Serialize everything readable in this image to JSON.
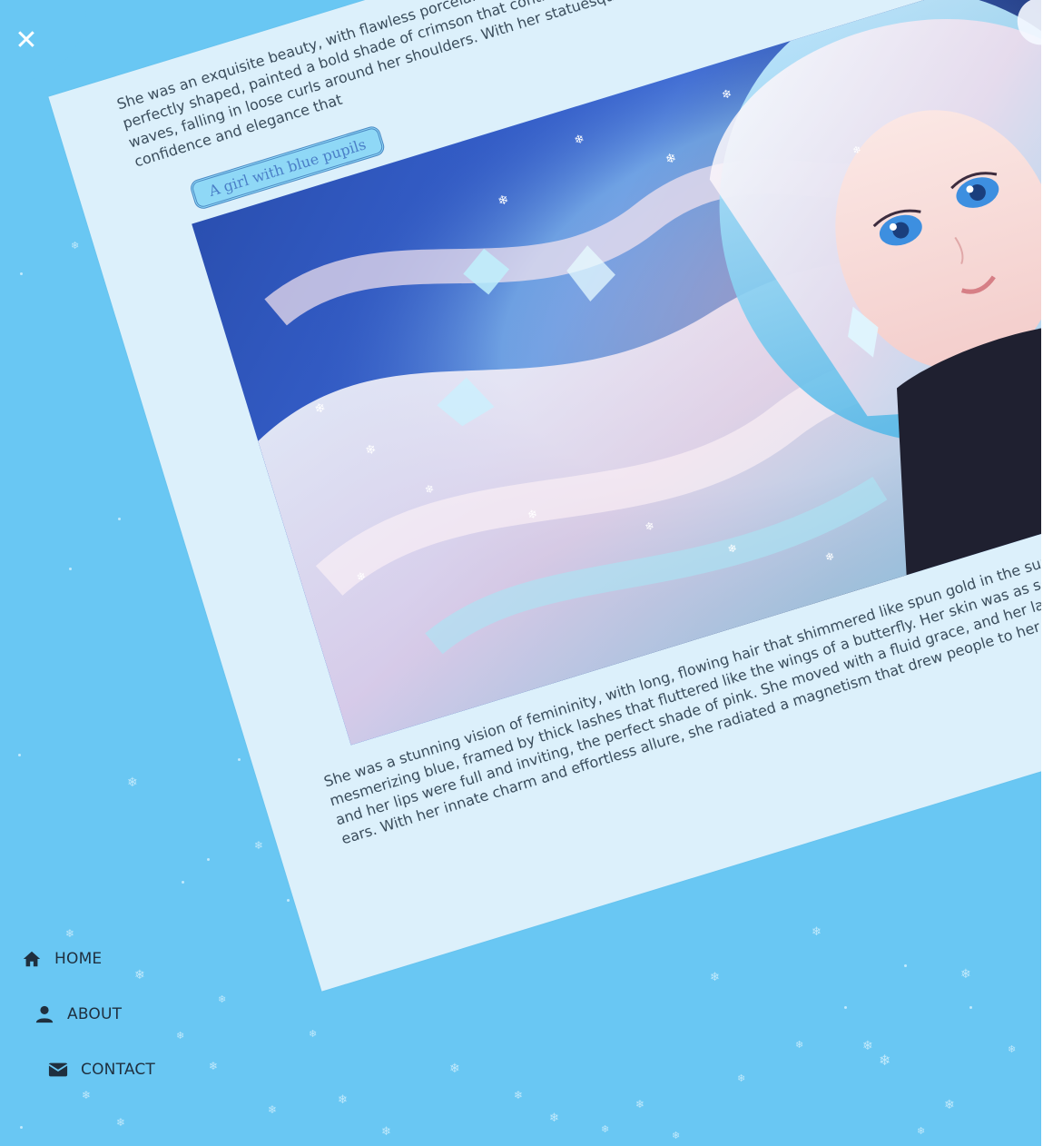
{
  "close": {
    "glyph": "✕"
  },
  "article": {
    "paragraph_top": "She was an exquisite beauty, with flawless porcelain skin and piercing eyes that sparkled like diamonds. Her lips were full and perfectly shaped, painted a bold shade of crimson that contrasted beautifully with her fair skin. Her hair was a cascade of chestnut waves, falling in loose curls around her shoulders. With her statuesque figure and graceful movements, she exuded an aura of confidence and elegance that",
    "caption": "A girl with blue pupils",
    "paragraph_bottom": "She was a stunning vision of femininity, with long, flowing hair that shimmered like spun gold in the sun. Her eyes were a deep, mesmerizing blue, framed by thick lashes that fluttered like the wings of a butterfly. Her skin was as soft as the petals of a rose, and her lips were full and inviting, the perfect shade of pink. She moved with a fluid grace, and her laughter was like music to the ears. With her innate charm and effortless allure, she radiated a magnetism that drew people to her like moths to a flame."
  },
  "nav": {
    "items": [
      {
        "label": "HOME",
        "icon": "home-icon"
      },
      {
        "label": "ABOUT",
        "icon": "user-icon"
      },
      {
        "label": "CONTACT",
        "icon": "envelope-icon"
      }
    ]
  },
  "colors": {
    "background": "#69c7f3",
    "card": "#dcf0fb",
    "caption_bg": "#8fd8f6",
    "caption_text": "#4a7fc7",
    "nav_text": "#1f2f3e"
  }
}
